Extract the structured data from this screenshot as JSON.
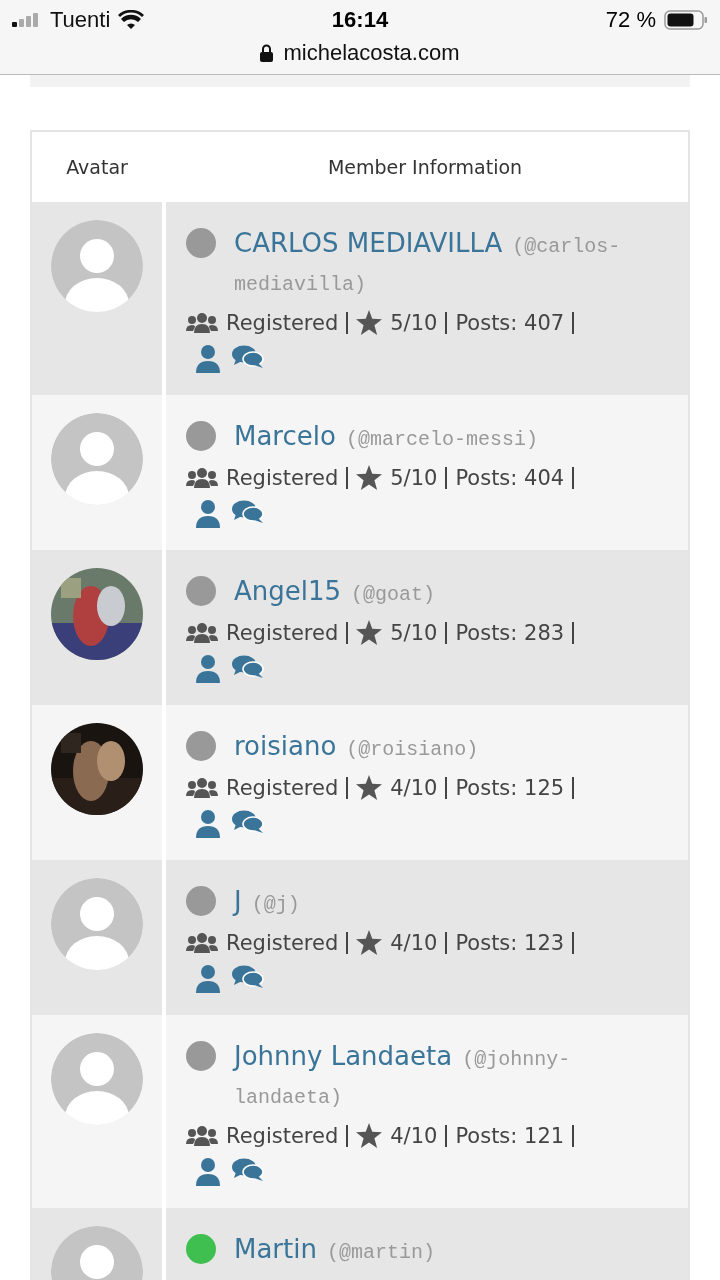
{
  "status_bar": {
    "carrier": "Tuenti",
    "time": "16:14",
    "battery": "72 %",
    "url": "michelacosta.com"
  },
  "table": {
    "columns": [
      "Avatar",
      "Member Information"
    ],
    "rows": [
      {
        "kind": "default",
        "online": false,
        "name": "CARLOS MEDIAVILLA",
        "handle": "(@carlos-mediavilla)",
        "role": "Registered",
        "rating": "5/10",
        "posts": "Posts: 407"
      },
      {
        "kind": "default",
        "online": false,
        "name": "Marcelo",
        "handle": "(@marcelo-messi)",
        "role": "Registered",
        "rating": "5/10",
        "posts": "Posts: 404"
      },
      {
        "kind": "picture",
        "online": false,
        "name": "Angel15",
        "handle": "(@goat)",
        "role": "Registered",
        "rating": "5/10",
        "posts": "Posts: 283"
      },
      {
        "kind": "picture",
        "online": false,
        "name": "roisiano",
        "handle": "(@roisiano)",
        "role": "Registered",
        "rating": "4/10",
        "posts": "Posts: 125"
      },
      {
        "kind": "default",
        "online": false,
        "name": "J",
        "handle": "(@j)",
        "role": "Registered",
        "rating": "4/10",
        "posts": "Posts: 123"
      },
      {
        "kind": "default",
        "online": false,
        "name": "Johnny Landaeta",
        "handle": "(@johnny-landaeta)",
        "role": "Registered",
        "rating": "4/10",
        "posts": "Posts: 121"
      },
      {
        "kind": "default",
        "online": true,
        "name": "Martin",
        "handle": "(@martin)"
      }
    ]
  }
}
